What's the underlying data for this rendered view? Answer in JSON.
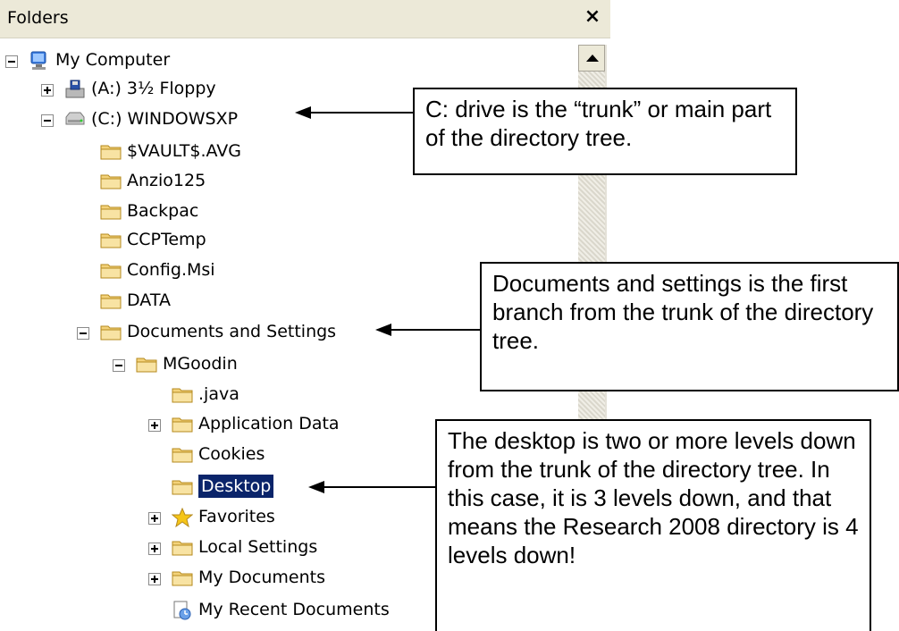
{
  "pane": {
    "title": "Folders",
    "close_label": "×"
  },
  "tree": [
    {
      "label": "My Computer",
      "icon": "computer-icon",
      "expander": "minus",
      "selected": false
    },
    {
      "label": "(A:) 3½ Floppy",
      "icon": "floppy-drive-icon",
      "expander": "plus",
      "selected": false
    },
    {
      "label": "(C:) WINDOWSXP",
      "icon": "hard-drive-icon",
      "expander": "minus",
      "selected": false
    },
    {
      "label": "$VAULT$.AVG",
      "icon": "folder-icon",
      "expander": "none",
      "selected": false
    },
    {
      "label": "Anzio125",
      "icon": "folder-icon",
      "expander": "none",
      "selected": false
    },
    {
      "label": "Backpac",
      "icon": "folder-icon",
      "expander": "none",
      "selected": false
    },
    {
      "label": "CCPTemp",
      "icon": "folder-icon",
      "expander": "none",
      "selected": false
    },
    {
      "label": "Config.Msi",
      "icon": "folder-icon",
      "expander": "none",
      "selected": false
    },
    {
      "label": "DATA",
      "icon": "folder-icon",
      "expander": "none",
      "selected": false
    },
    {
      "label": "Documents and Settings",
      "icon": "folder-icon",
      "expander": "minus",
      "selected": false
    },
    {
      "label": "MGoodin",
      "icon": "folder-icon",
      "expander": "minus",
      "selected": false
    },
    {
      "label": ".java",
      "icon": "folder-icon",
      "expander": "none",
      "selected": false
    },
    {
      "label": "Application Data",
      "icon": "folder-icon",
      "expander": "plus",
      "selected": false
    },
    {
      "label": "Cookies",
      "icon": "folder-icon",
      "expander": "none",
      "selected": false
    },
    {
      "label": "Desktop",
      "icon": "folder-icon",
      "expander": "none",
      "selected": true
    },
    {
      "label": "Favorites",
      "icon": "star-icon",
      "expander": "plus",
      "selected": false
    },
    {
      "label": "Local Settings",
      "icon": "folder-icon",
      "expander": "plus",
      "selected": false
    },
    {
      "label": "My Documents",
      "icon": "folder-icon",
      "expander": "plus",
      "selected": false
    },
    {
      "label": "My Recent Documents",
      "icon": "recent-documents-icon",
      "expander": "none",
      "selected": false
    }
  ],
  "callouts": {
    "trunk": "C: drive is the “trunk” or main part of the directory tree.",
    "branch": "Documents and settings is the first branch from the trunk of the directory tree.",
    "desktop": "The desktop is two or more levels down from the trunk of the directory tree. In this case, it is 3 levels down, and that means the Research 2008 directory is 4 levels down!"
  },
  "colors": {
    "selection": "#0a246a",
    "folder": "#f3d27a",
    "header": "#ece9d8"
  }
}
